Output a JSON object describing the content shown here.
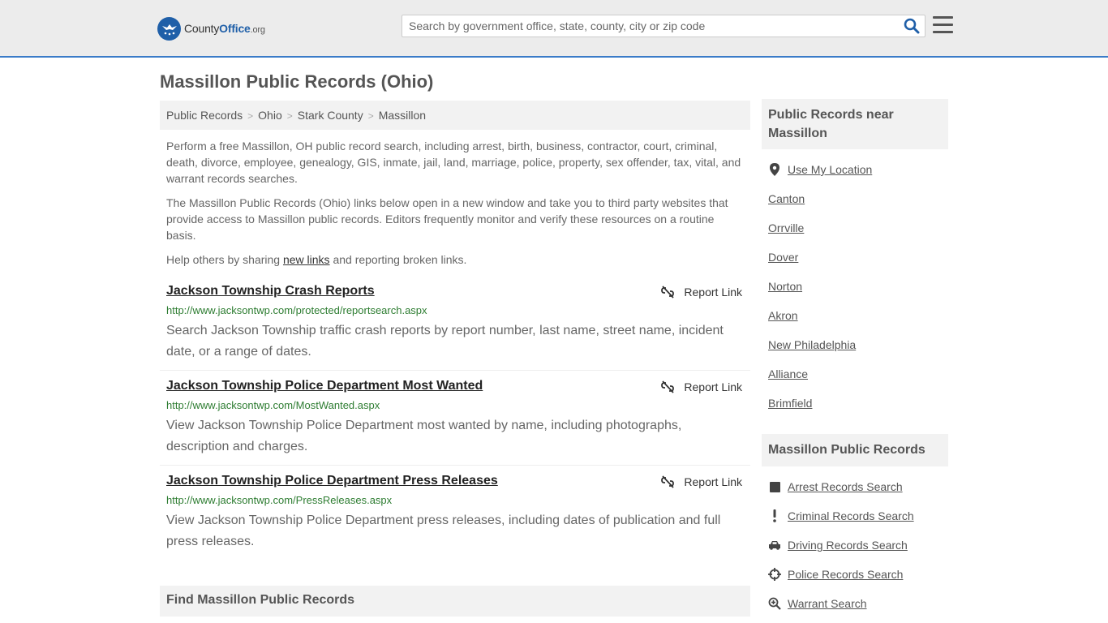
{
  "header": {
    "logo_brand": "County",
    "logo_office": "Office",
    "logo_tld": ".org",
    "search_placeholder": "Search by government office, state, county, city or zip code"
  },
  "page": {
    "title": "Massillon Public Records (Ohio)"
  },
  "breadcrumb": [
    {
      "label": "Public Records"
    },
    {
      "label": "Ohio"
    },
    {
      "label": "Stark County"
    },
    {
      "label": "Massillon"
    }
  ],
  "intro": {
    "p1": "Perform a free Massillon, OH public record search, including arrest, birth, business, contractor, court, criminal, death, divorce, employee, genealogy, GIS, inmate, jail, land, marriage, police, property, sex offender, tax, vital, and warrant records searches.",
    "p2": "The Massillon Public Records (Ohio) links below open in a new window and take you to third party websites that provide access to Massillon public records. Editors frequently monitor and verify these resources on a routine basis.",
    "p3_before": "Help others by sharing ",
    "p3_link": "new links",
    "p3_after": " and reporting broken links."
  },
  "links": [
    {
      "title": "Jackson Township Crash Reports",
      "url": "http://www.jacksontwp.com/protected/reportsearch.aspx",
      "desc": "Search Jackson Township traffic crash reports by report number, last name, street name, incident date, or a range of dates.",
      "report_label": "Report Link"
    },
    {
      "title": "Jackson Township Police Department Most Wanted",
      "url": "http://www.jacksontwp.com/MostWanted.aspx",
      "desc": "View Jackson Township Police Department most wanted by name, including photographs, description and charges.",
      "report_label": "Report Link"
    },
    {
      "title": "Jackson Township Police Department Press Releases",
      "url": "http://www.jacksontwp.com/PressReleases.aspx",
      "desc": "View Jackson Township Police Department press releases, including dates of publication and full press releases.",
      "report_label": "Report Link"
    }
  ],
  "find_bar": {
    "title": "Find Massillon Public Records"
  },
  "sidebar": {
    "near_title": "Public Records near Massillon",
    "use_location": "Use My Location",
    "nearby": [
      "Canton",
      "Orrville",
      "Dover",
      "Norton",
      "Akron",
      "New Philadelphia",
      "Alliance",
      "Brimfield"
    ],
    "records_title": "Massillon Public Records",
    "records": [
      {
        "label": "Arrest Records Search",
        "icon": "square-icon"
      },
      {
        "label": "Criminal Records Search",
        "icon": "exclamation-icon"
      },
      {
        "label": "Driving Records Search",
        "icon": "car-icon"
      },
      {
        "label": "Police Records Search",
        "icon": "crosshair-icon"
      },
      {
        "label": "Warrant Search",
        "icon": "search-plus-icon"
      }
    ]
  },
  "colors": {
    "accent": "#3a7bc8",
    "url_green": "#2e7d32",
    "logo_blue": "#1f5fa8"
  }
}
